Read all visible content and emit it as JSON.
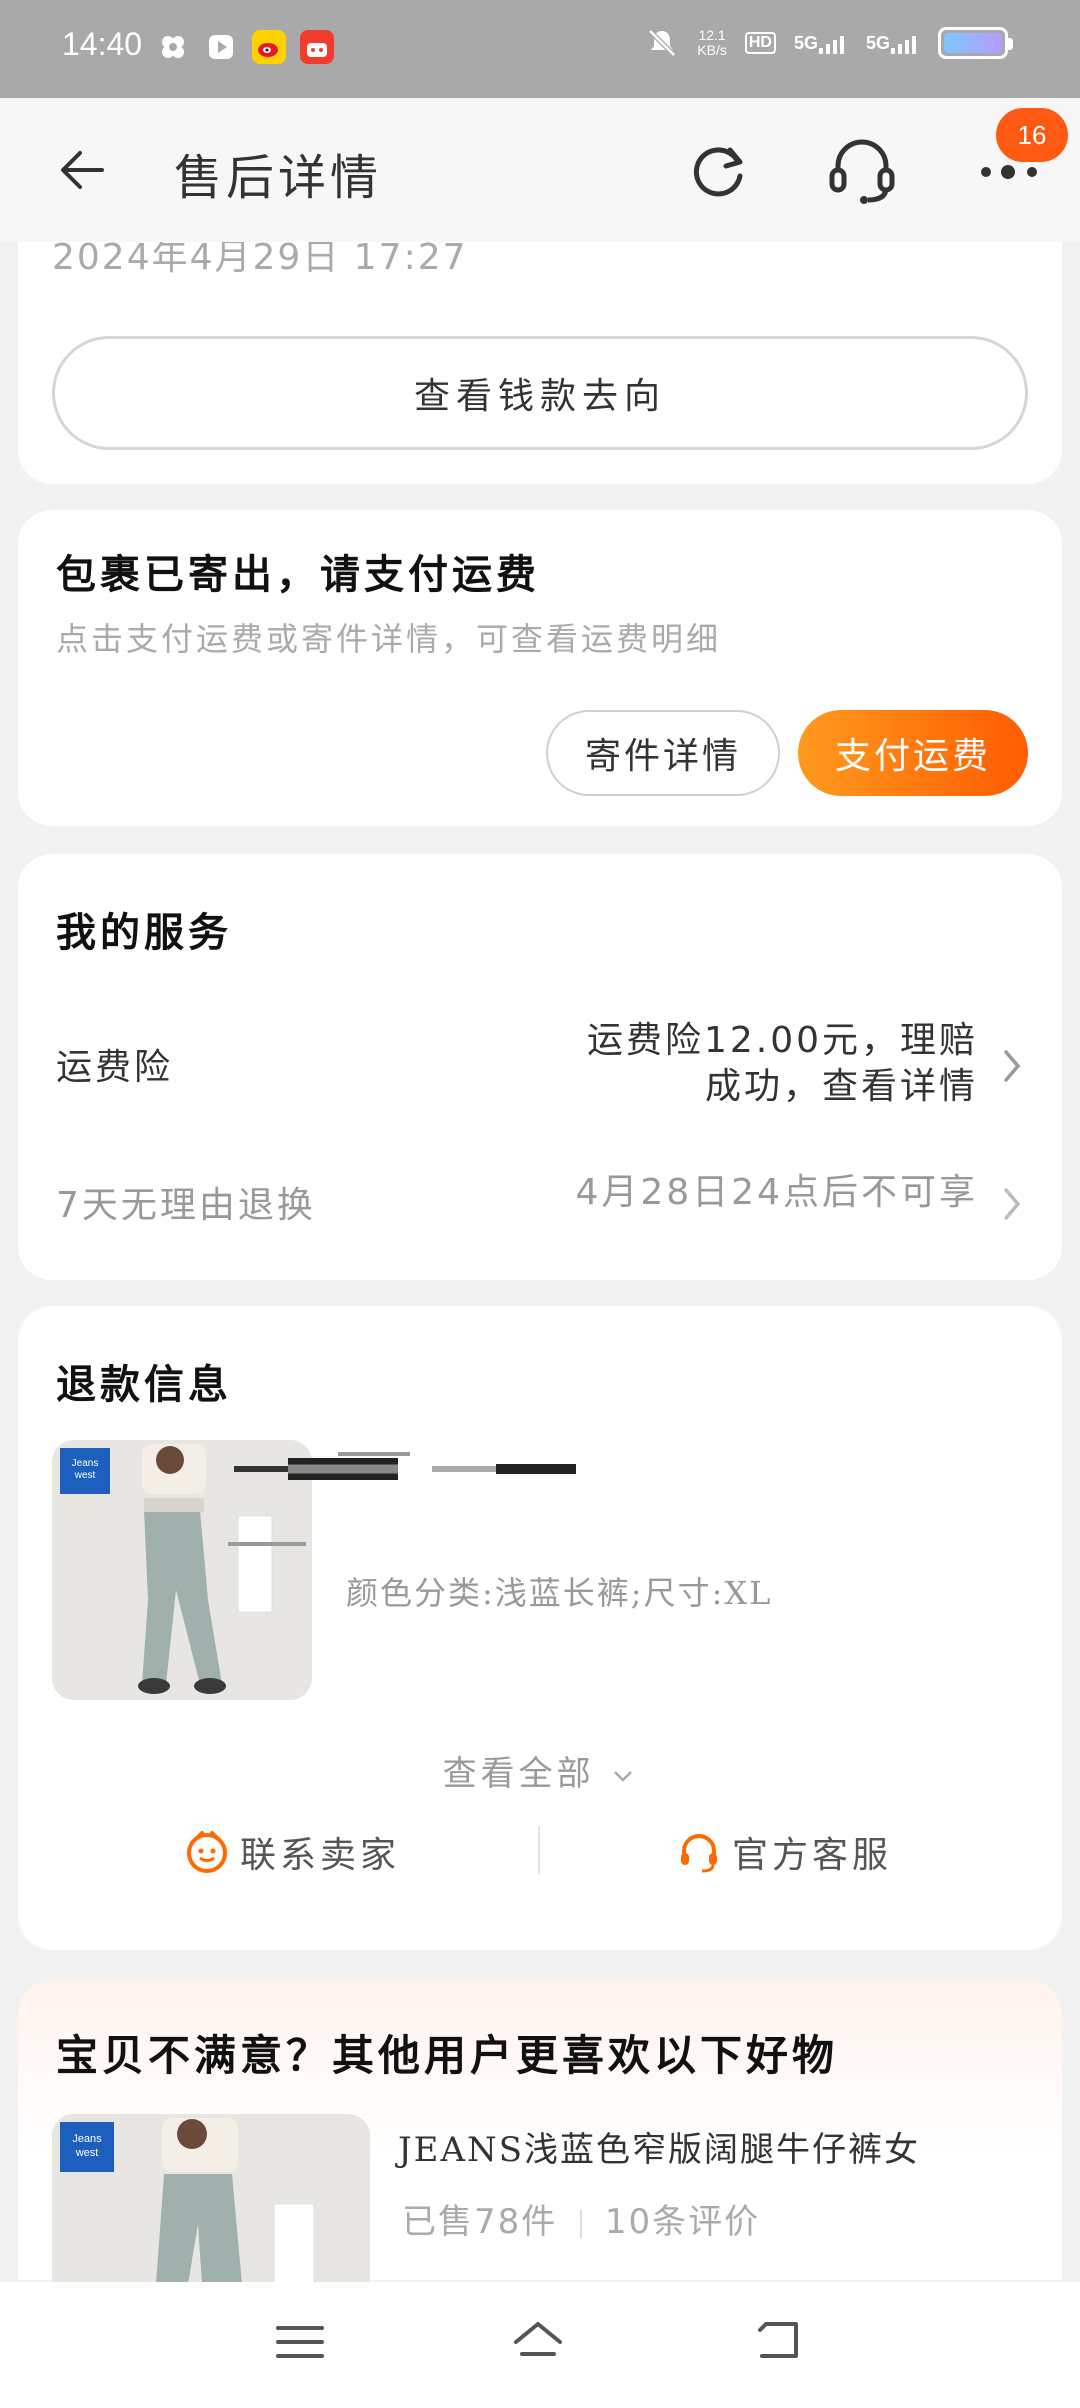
{
  "status_bar": {
    "time": "14:40",
    "speed_value": "12.1",
    "speed_unit": "KB/s",
    "hd_label": "HD",
    "net1": "5G",
    "net2": "5G"
  },
  "header": {
    "title": "售后详情",
    "badge_count": "16"
  },
  "top_card": {
    "date_partial": "2024年4月29日 17:27",
    "money_button": "查看钱款去向"
  },
  "shipping_card": {
    "title": "包裹已寄出，请支付运费",
    "subtitle": "点击支付运费或寄件详情，可查看运费明细",
    "detail_button": "寄件详情",
    "pay_button": "支付运费"
  },
  "service_card": {
    "title": "我的服务",
    "insurance_label": "运费险",
    "insurance_value_line1": "运费险12.00元，理赔",
    "insurance_value_line2": "成功，查看详情",
    "return_label": "7天无理由退换",
    "return_value": "4月28日24点后不可享"
  },
  "refund_card": {
    "title": "退款信息",
    "spec": "颜色分类:浅蓝长裤;尺寸:XL",
    "view_all": "查看全部",
    "contact_seller": "联系卖家",
    "official_service": "官方客服"
  },
  "recommend": {
    "title": "宝贝不满意？其他用户更喜欢以下好物",
    "product_name": "JEANS浅蓝色窄版阔腿牛仔裤女",
    "sold": "已售78件",
    "reviews": "10条评价"
  },
  "colors": {
    "accent_orange": "#ff5c00",
    "badge": "#ff5a14",
    "background": "#f2f2f2"
  }
}
